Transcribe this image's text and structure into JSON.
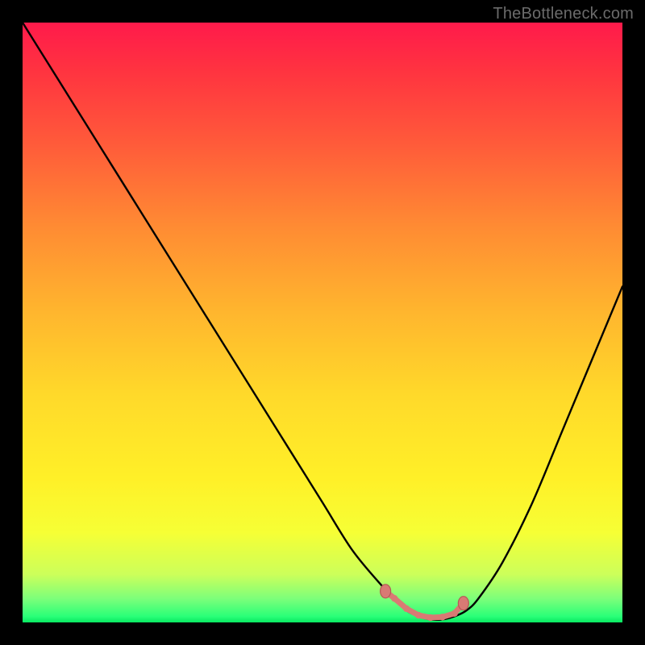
{
  "watermark": "TheBottleneck.com",
  "colors": {
    "frame": "#000000",
    "curve_stroke": "#000000",
    "marker_fill": "#d97a74",
    "marker_stroke": "#b45a54",
    "gradient_top": "#ff1a4b",
    "gradient_bottom": "#08e860"
  },
  "chart_data": {
    "type": "line",
    "title": "",
    "xlabel": "",
    "ylabel": "",
    "xlim": [
      0,
      100
    ],
    "ylim": [
      0,
      100
    ],
    "grid": false,
    "series": [
      {
        "name": "bottleneck-curve",
        "x": [
          0,
          5,
          10,
          15,
          20,
          25,
          30,
          35,
          40,
          45,
          50,
          55,
          60,
          62,
          64,
          66,
          68,
          70,
          72,
          74,
          76,
          80,
          85,
          90,
          95,
          100
        ],
        "values": [
          100,
          92,
          84,
          76,
          68,
          60,
          52,
          44,
          36,
          28,
          20,
          12,
          6,
          4,
          2,
          1,
          0.5,
          0.5,
          1,
          2,
          4,
          10,
          20,
          32,
          44,
          56
        ]
      }
    ],
    "markers": {
      "name": "highlight-band",
      "x": [
        60.5,
        62,
        64,
        66,
        68,
        70,
        72,
        73.5
      ],
      "values": [
        5.2,
        4,
        2.3,
        1.2,
        0.8,
        0.9,
        1.5,
        3.2
      ]
    }
  }
}
